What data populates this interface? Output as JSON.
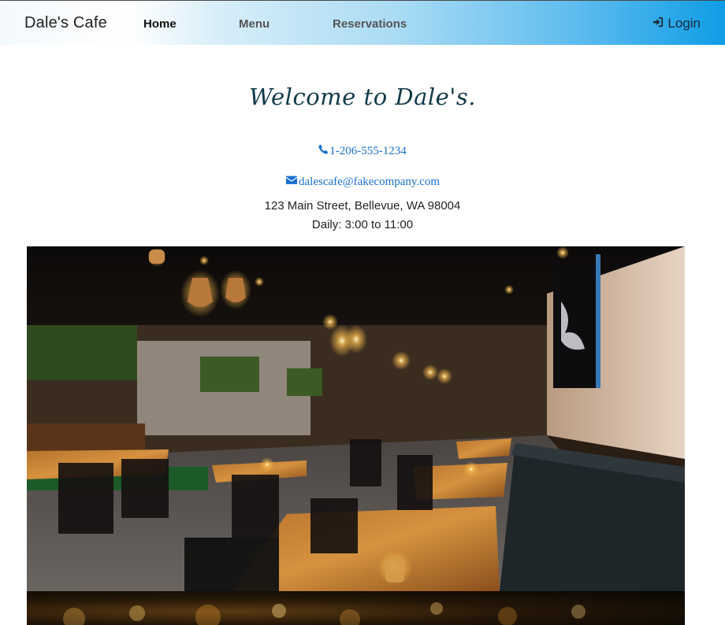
{
  "navbar": {
    "brand": "Dale's Cafe",
    "links": [
      "Home",
      "Menu",
      "Reservations"
    ],
    "active": "Home",
    "login_label": "Login",
    "gradient_end_color": "#0f9de6"
  },
  "hero": {
    "title": "Welcome to Dale's."
  },
  "contact": {
    "phone": "1-206-555-1234",
    "email": "dalescafe@fakecompany.com",
    "address": "123 Main Street, Bellevue, WA 98004",
    "hours": "Daily: 3:00 to 11:00"
  },
  "link_color": "#1a6fcf"
}
